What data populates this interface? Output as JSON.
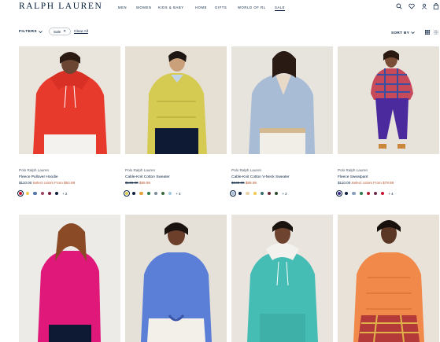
{
  "brand": {
    "logo": "RALPH LAUREN"
  },
  "nav": [
    "MEN",
    "WOMEN",
    "KIDS & BABY",
    "HOME",
    "GIFTS",
    "WORLD OF RL",
    "SALE"
  ],
  "header_icons": [
    "search-icon",
    "heart-icon",
    "account-icon",
    "bag-icon"
  ],
  "filter_bar": {
    "filters_label": "FILTERS",
    "chip_label": "Sale",
    "chip_remove": "✕",
    "clear_all": "Clear All",
    "sort_label": "SORT BY"
  },
  "products": [
    {
      "brand": "Polo Ralph Lauren",
      "name": "Fleece Pullover Hoodie",
      "price": "$110.00",
      "old_price": "",
      "sale_price": "Select colors From $54.99",
      "swatches": [
        "#c8102e",
        "#f2c94c",
        "#5577aa",
        "#9b4466",
        "#7a1e3a",
        "#0d1f3d"
      ],
      "more": "+ 2"
    },
    {
      "brand": "Polo Ralph Lauren",
      "name": "Cable-Knit Cotton Sweater",
      "price": "",
      "old_price": "$138.00",
      "sale_price": "$89.99",
      "swatches": [
        "#d9cc4e",
        "#0d1f3d",
        "#e8a33c",
        "#2a7a4a",
        "#7a8a9a",
        "#3a6a3a",
        "#a4c8e0"
      ],
      "more": "+ 4"
    },
    {
      "brand": "Polo Ralph Lauren",
      "name": "Cable-Knit Cotton V-Neck Sweater",
      "price": "",
      "old_price": "$138.00",
      "sale_price": "$89.99",
      "swatches": [
        "#a9bcd6",
        "#0d1f3d",
        "#e8d3a8",
        "#f2c94c",
        "#3a6a6a",
        "#6a2a3a",
        "#2a4a2a"
      ],
      "more": "+ 2"
    },
    {
      "brand": "Polo Ralph Lauren",
      "name": "Fleece Sweatpant",
      "price": "$110.00",
      "old_price": "",
      "sale_price": "Select colors From $79.99",
      "swatches": [
        "#3a2a8a",
        "#0d1f3d",
        "#8aa0c0",
        "#2a7a4a",
        "#b02030",
        "#6a2a4a",
        "#c8102e"
      ],
      "more": "+ 4"
    }
  ]
}
